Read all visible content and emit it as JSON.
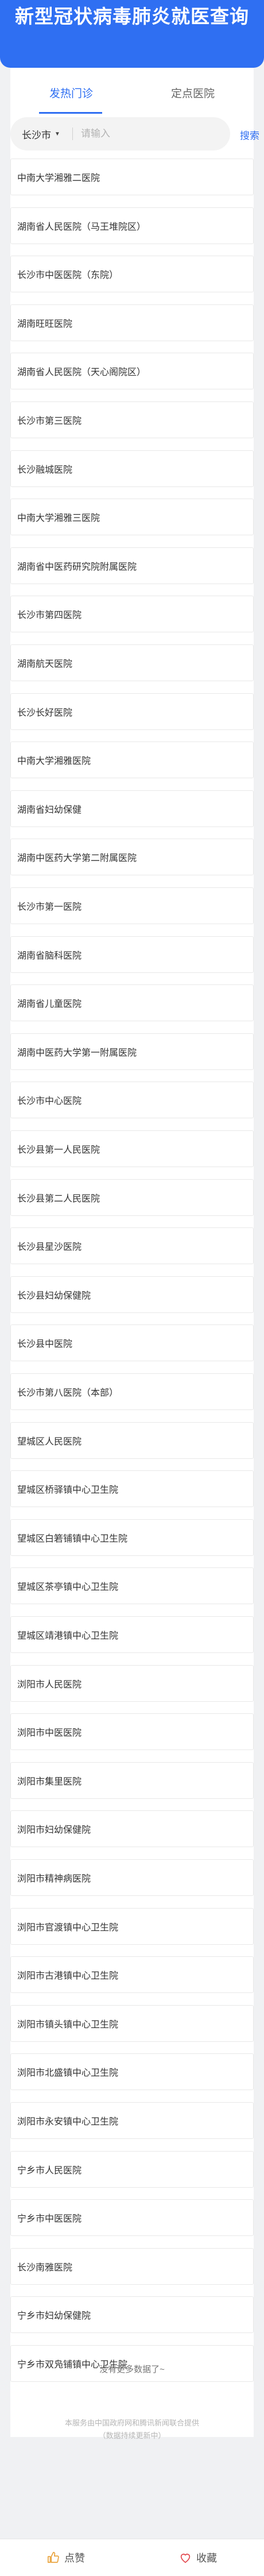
{
  "header": {
    "title": "新型冠状病毒肺炎就医查询"
  },
  "tabs": [
    {
      "label": "发热门诊"
    },
    {
      "label": "定点医院"
    }
  ],
  "search": {
    "city": "长沙市",
    "placeholder": "请输入",
    "value": "",
    "button_label": "搜索"
  },
  "hospitals": [
    "中南大学湘雅二医院",
    "湖南省人民医院（马王堆院区）",
    "长沙市中医医院（东院）",
    "湖南旺旺医院",
    "湖南省人民医院（天心阁院区）",
    "长沙市第三医院",
    "长沙融城医院",
    "中南大学湘雅三医院",
    "湖南省中医药研究院附属医院",
    "长沙市第四医院",
    "湖南航天医院",
    "长沙长好医院",
    "中南大学湘雅医院",
    "湖南省妇幼保健",
    "湖南中医药大学第二附属医院",
    "长沙市第一医院",
    "湖南省脑科医院",
    "湖南省儿童医院",
    "湖南中医药大学第一附属医院",
    "长沙市中心医院",
    "长沙县第一人民医院",
    "长沙县第二人民医院",
    "长沙县星沙医院",
    "长沙县妇幼保健院",
    "长沙县中医院",
    "长沙市第八医院（本部）",
    "望城区人民医院",
    "望城区桥驿镇中心卫生院",
    "望城区白箬铺镇中心卫生院",
    "望城区茶亭镇中心卫生院",
    "望城区靖港镇中心卫生院",
    "浏阳市人民医院",
    "浏阳市中医医院",
    "浏阳市集里医院",
    "浏阳市妇幼保健院",
    "浏阳市精神病医院",
    "浏阳市官渡镇中心卫生院",
    "浏阳市古港镇中心卫生院",
    "浏阳市镇头镇中心卫生院",
    "浏阳市北盛镇中心卫生院",
    "浏阳市永安镇中心卫生院",
    "宁乡市人民医院",
    "宁乡市中医医院",
    "长沙南雅医院",
    "宁乡市妇幼保健院",
    "宁乡市双凫铺镇中心卫生院"
  ],
  "no_more_text": "没有更多数据了~",
  "footer_note": {
    "line1": "本服务由中国政府网和腾讯新闻联合提供",
    "line2": "（数据持续更新中）"
  },
  "bottom_bar": {
    "like_label": "点赞",
    "favorite_label": "收藏"
  },
  "colors": {
    "brand_blue": "#2f6ff2",
    "page_background": "#f0f1f3"
  },
  "icons": {
    "like": "thumbs-up-icon",
    "favorite": "heart-icon"
  }
}
